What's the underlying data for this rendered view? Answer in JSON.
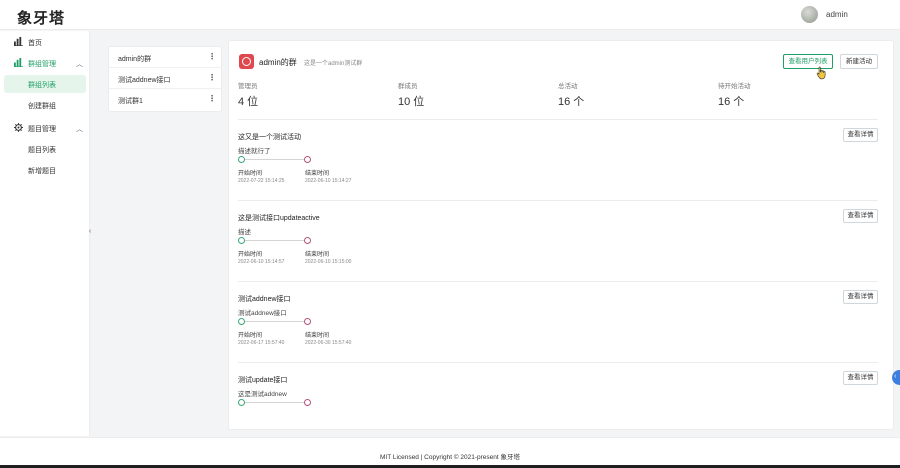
{
  "app": {
    "title": "象牙塔",
    "username": "admin",
    "footer": "MIT Licensed | Copyright © 2021-present 象牙塔"
  },
  "sidebar": {
    "home": "首页",
    "group_manage": "群组管理",
    "group_list": "群组列表",
    "create_group": "创建群组",
    "question_manage": "题目管理",
    "question_list": "题目列表",
    "add_question": "新增题目"
  },
  "groups": [
    {
      "name": "admin的群"
    },
    {
      "name": "测试addnew接口"
    },
    {
      "name": "测试群1"
    }
  ],
  "group": {
    "name": "admin的群",
    "desc": "这是一个admin测试群",
    "btn_users": "查看用户列表",
    "btn_new": "新建活动"
  },
  "stats": [
    {
      "label": "管理员",
      "value": "4 位"
    },
    {
      "label": "群成员",
      "value": "10 位"
    },
    {
      "label": "总活动",
      "value": "16 个"
    },
    {
      "label": "待开始活动",
      "value": "16 个"
    }
  ],
  "activities": [
    {
      "title": "这又是一个测试活动",
      "desc": "描述就行了",
      "start_label": "开始时间",
      "start": "2022-07-22 15:14:25",
      "end_label": "结束时间",
      "end": "2022-06-10 15:14:27",
      "detail": "查看详情"
    },
    {
      "title": "这是测试接口updateactive",
      "desc": "描述",
      "start_label": "开始时间",
      "start": "2022-06-10 15:14:57",
      "end_label": "结束时间",
      "end": "2022-06-10 15:15:00",
      "detail": "查看详情"
    },
    {
      "title": "测试addnew接口",
      "desc": "测试addnew接口",
      "start_label": "开始时间",
      "start": "2022-06-17 15:57:40",
      "end_label": "结束时间",
      "end": "2022-06-30 15:57:40",
      "detail": "查看详情"
    },
    {
      "title": "测试update接口",
      "desc": "这是测试addnew",
      "start_label": "",
      "start": "",
      "end_label": "",
      "end": "",
      "detail": "查看详情"
    }
  ],
  "colors": {
    "accent": "#1e9e63",
    "end_dot": "#b0547a",
    "group_icon": "#e0484f"
  }
}
